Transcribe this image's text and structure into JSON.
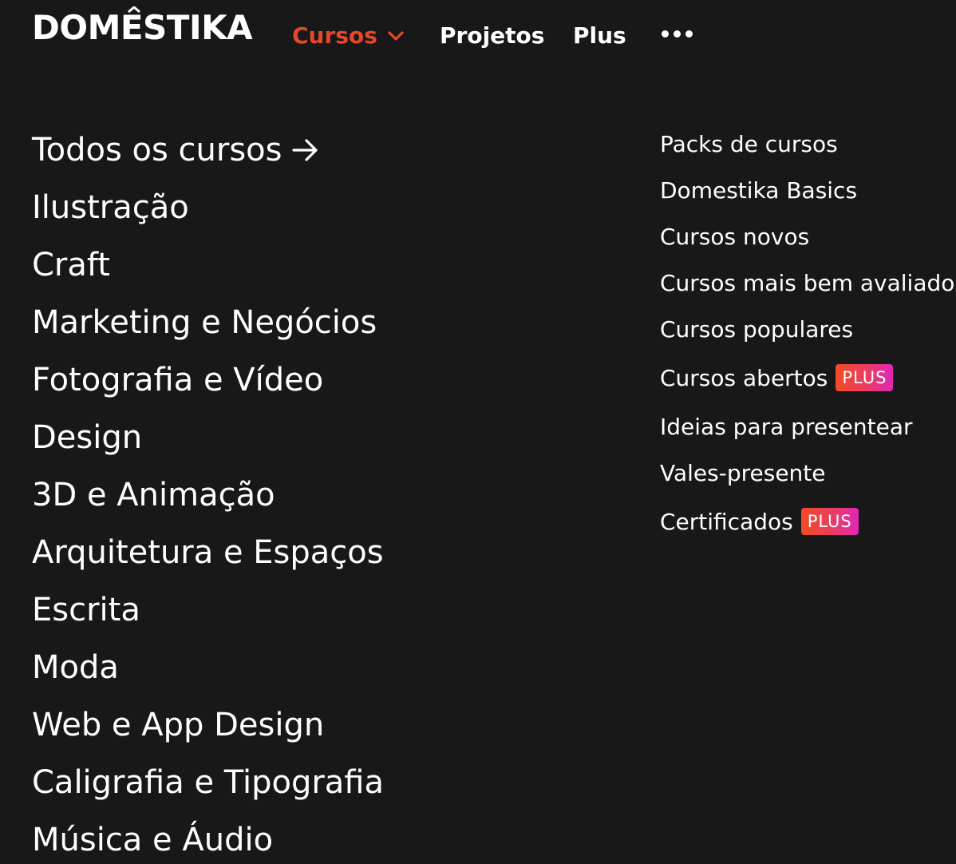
{
  "header": {
    "logo_text": "DOMESTIKA",
    "nav": {
      "cursos": "Cursos",
      "projetos": "Projetos",
      "plus": "Plus"
    },
    "accent_color": "#e5472b"
  },
  "categories": {
    "all": "Todos os cursos",
    "items": [
      "Ilustração",
      "Craft",
      "Marketing e Negócios",
      "Fotografia e Vídeo",
      "Design",
      "3D e Animação",
      "Arquitetura e Espaços",
      "Escrita",
      "Moda",
      "Web e App Design",
      "Caligrafia e Tipografia",
      "Música e Áudio"
    ]
  },
  "extras": {
    "items": [
      "Packs de cursos",
      "Domestika Basics",
      "Cursos novos",
      "Cursos mais bem avaliados",
      "Cursos populares",
      "Cursos abertos",
      "Ideias para presentear",
      "Vales-presente",
      "Certificados"
    ],
    "badge": "PLUS"
  },
  "icons": {
    "chevron": "chevron-down-icon",
    "more": "more-dots-icon",
    "arrow": "arrow-right-icon"
  }
}
